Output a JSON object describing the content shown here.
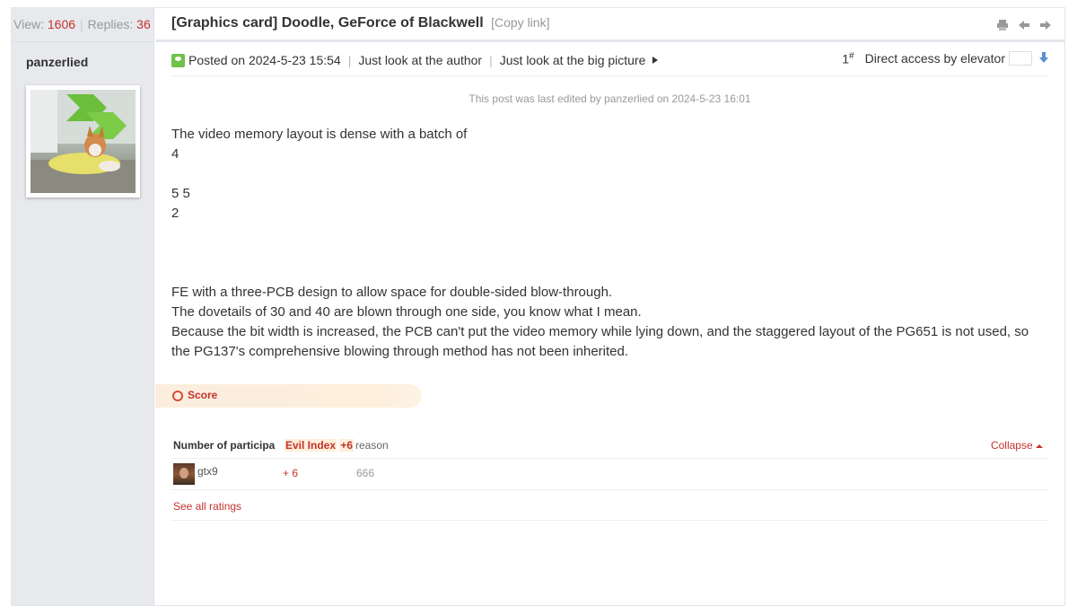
{
  "stats": {
    "view_label": "View:",
    "view_count": "1606",
    "replies_label": "Replies:",
    "replies_count": "36"
  },
  "thread": {
    "title": "[Graphics card] Doodle, GeForce of Blackwell",
    "copy_link": "[Copy link]"
  },
  "author": {
    "name": "panzerlied"
  },
  "post": {
    "posted_on": "Posted on 2024-5-23 15:54",
    "only_author": "Just look at the author",
    "big_picture": "Just look at the big picture",
    "floor": "1",
    "floor_sup": "#",
    "elevator": "Direct access by elevator",
    "edited_note": "This post was last edited by panzerlied on 2024-5-23 16:01",
    "lines": {
      "l1": "The video memory layout is dense with a batch of",
      "l2": "4",
      "l3": "5 5",
      "l4": "2",
      "l5": "FE with a three-PCB design to allow space for double-sided blow-through.",
      "l6": "The dovetails of 30 and 40 are blown through one side, you know what I mean.",
      "l7": "Because the bit width is increased, the PCB can't put the video memory while lying down, and the staggered layout of the PG651 is not used, so the PG137's comprehensive blowing through method has not been inherited."
    }
  },
  "score": {
    "label": "Score",
    "header_participants": "Number of participa",
    "header_index": "Evil Index",
    "header_index_value": "+6",
    "header_reason": "reason",
    "collapse": "Collapse",
    "rows": [
      {
        "user": "gtx9",
        "points": "+ 6",
        "reason": "666"
      }
    ],
    "see_all": "See all ratings"
  },
  "colors": {
    "accent_red": "#c4322c",
    "sidebar_bg": "#e7e9ed",
    "online_green": "#6fc24a",
    "score_bg": "#fdefdc"
  }
}
